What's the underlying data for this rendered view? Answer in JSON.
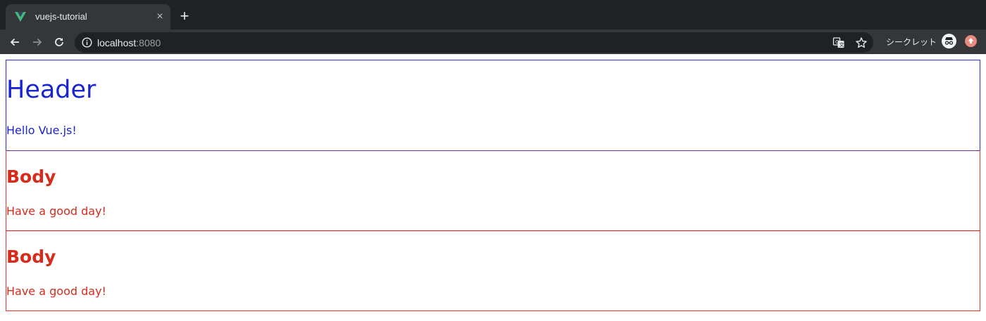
{
  "browser": {
    "tab": {
      "title": "vuejs-tutorial",
      "favicon": "vue-logo-icon",
      "close_glyph": "×"
    },
    "new_tab_glyph": "+",
    "address_bar": {
      "host": "localhost",
      "port": ":8080",
      "site_info_icon": "info-icon"
    },
    "toolbar_icons": [
      "back-arrow-icon",
      "forward-arrow-icon",
      "reload-icon",
      "translate-icon",
      "bookmark-star-icon"
    ],
    "profile": {
      "label": "シークレット",
      "icon": "incognito-icon"
    },
    "update_icon": "update-arrow-icon",
    "colors": {
      "frame": "#202124",
      "toolbar": "#35363a",
      "text": "#e8eaed",
      "muted": "#9aa0a6"
    }
  },
  "page": {
    "header": {
      "title": "Header",
      "message": "Hello Vue.js!",
      "color": "#1a24d0"
    },
    "bodies": [
      {
        "title": "Body",
        "message": "Have a good day!",
        "color": "#d82b1b"
      },
      {
        "title": "Body",
        "message": "Have a good day!",
        "color": "#d82b1b"
      }
    ]
  }
}
